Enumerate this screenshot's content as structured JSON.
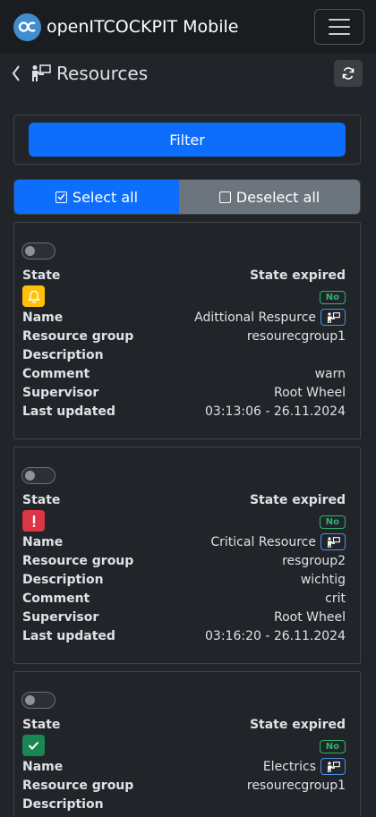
{
  "app": {
    "title": "openITCOCKPIT Mobile",
    "logo_icon": "oitc-logo-icon",
    "menu_icon": "hamburger-icon"
  },
  "page": {
    "title": "Resources",
    "back_icon": "chevron-left-icon",
    "title_icon": "resource-icon",
    "refresh_icon": "refresh-icon"
  },
  "filter": {
    "label": "Filter"
  },
  "selection": {
    "select_all": "Select all",
    "deselect_all": "Deselect all"
  },
  "labels": {
    "state": "State",
    "state_expired": "State expired",
    "name": "Name",
    "resource_group": "Resource group",
    "description": "Description",
    "comment": "Comment",
    "supervisor": "Supervisor",
    "last_updated": "Last updated"
  },
  "resources": [
    {
      "state": "warning",
      "state_icon": "bell-icon",
      "state_color": "#ffc107",
      "expired": "No",
      "name": "Adittional Respurce",
      "group": "resourecgroup1",
      "description": "",
      "comment": "warn",
      "supervisor": "Root Wheel",
      "last_updated": "03:13:06 - 26.11.2024"
    },
    {
      "state": "critical",
      "state_icon": "exclamation-icon",
      "state_color": "#dc3545",
      "expired": "No",
      "name": "Critical Resource",
      "group": "resgroup2",
      "description": "wichtig",
      "comment": "crit",
      "supervisor": "Root Wheel",
      "last_updated": "03:16:20 - 26.11.2024"
    },
    {
      "state": "ok",
      "state_icon": "check-icon",
      "state_color": "#198754",
      "expired": "No",
      "name": "Electrics",
      "group": "resourecgroup1",
      "description": ""
    }
  ],
  "colors": {
    "primary": "#0d6efd",
    "secondary": "#6c757d",
    "success": "#2fb36a",
    "link": "#2f7ff5",
    "background": "#212529"
  }
}
